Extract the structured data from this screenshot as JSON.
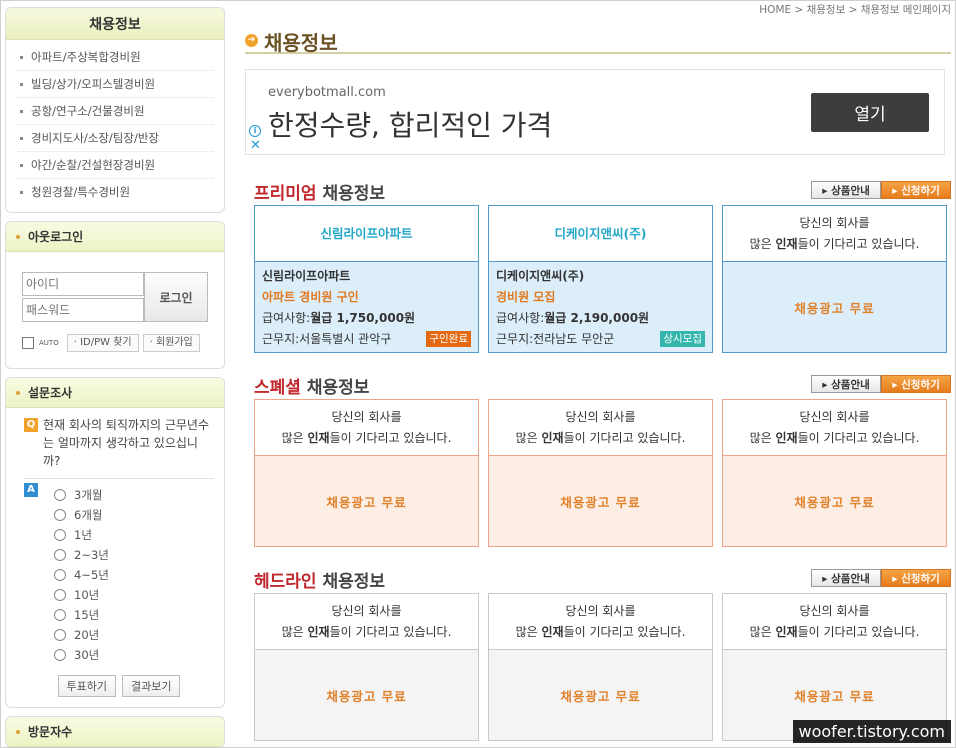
{
  "sidebar": {
    "category": {
      "title": "채용정보",
      "items": [
        "아파트/주상복합경비원",
        "빌딩/상가/오피스텔경비원",
        "공항/연구소/건물경비원",
        "경비지도사/소장/팀장/반장",
        "야간/순찰/건설현장경비원",
        "청원경찰/특수경비원"
      ]
    },
    "login": {
      "title": "아웃로그인",
      "id_placeholder": "아이디",
      "pw_placeholder": "패스워드",
      "login_label": "로그인",
      "auto_label": "AUTO",
      "find_label": "ID/PW 찾기",
      "join_label": "회원가입"
    },
    "poll": {
      "title": "설문조사",
      "q_badge": "Q",
      "a_badge": "A",
      "question": "현재 회사의 퇴직까지의 근무년수는 얼마까지 생각하고 있으십니까?",
      "options": [
        "3개월",
        "6개월",
        "1년",
        "2~3년",
        "4~5년",
        "10년",
        "15년",
        "20년",
        "30년"
      ],
      "vote_label": "투표하기",
      "result_label": "결과보기"
    },
    "visitors": {
      "title": "방문자수"
    }
  },
  "main": {
    "breadcrumb": "HOME > 채용정보 > 채용정보 메인페이지",
    "title": "채용정보",
    "ad": {
      "domain": "everybotmall.com",
      "headline": "한정수량, 합리적인 가격",
      "button": "열기",
      "info_glyph": "i",
      "close_glyph": "✕"
    },
    "sections": {
      "premium": {
        "title_hl": "프리미엄",
        "title_rest": " 채용정보",
        "info_label": "상품안내",
        "apply_label": "신청하기",
        "cards": [
          {
            "company": "신림라이프아파트",
            "name": "신림라이프아파트",
            "job": "아파트 경비원 구인",
            "pay_label": "급여사항:",
            "pay": "월급 1,750,000원",
            "location": "근무지:서울특별시 관악구",
            "badge": "구인완료"
          },
          {
            "company": "디케이지앤씨(주)",
            "name": "디케이지앤씨(주)",
            "job": "경비원 모집",
            "pay_label": "급여사항:",
            "pay": "월급 2,190,000원",
            "location": "근무지:전라남도 무안군",
            "badge": "상시모집"
          }
        ],
        "empty_line1": "당신의 회사를",
        "empty_line2_pre": "많은 ",
        "empty_line2_b": "인재",
        "empty_line2_post": "들이 기다리고 있습니다.",
        "free": "채용광고 무료"
      },
      "special": {
        "title_hl": "스폐셜",
        "title_rest": " 채용정보",
        "info_label": "상품안내",
        "apply_label": "신청하기",
        "empty_line1": "당신의 회사를",
        "empty_line2_pre": "많은 ",
        "empty_line2_b": "인재",
        "empty_line2_post": "들이 기다리고 있습니다.",
        "free": "채용광고 무료"
      },
      "headline": {
        "title_hl": "헤드라인",
        "title_rest": " 채용정보",
        "info_label": "상품안내",
        "apply_label": "신청하기",
        "empty_line1": "당신의 회사를",
        "empty_line2_pre": "많은 ",
        "empty_line2_b": "인재",
        "empty_line2_post": "들이 기다리고 있습니다.",
        "free": "채용광고 무료"
      }
    }
  },
  "watermark": "woofer.tistory.com",
  "colors": {
    "accent_orange": "#f0a22a",
    "premium_border": "#4f9bd0",
    "special_border": "#f0a48a",
    "headline_red": "#c0282d"
  }
}
